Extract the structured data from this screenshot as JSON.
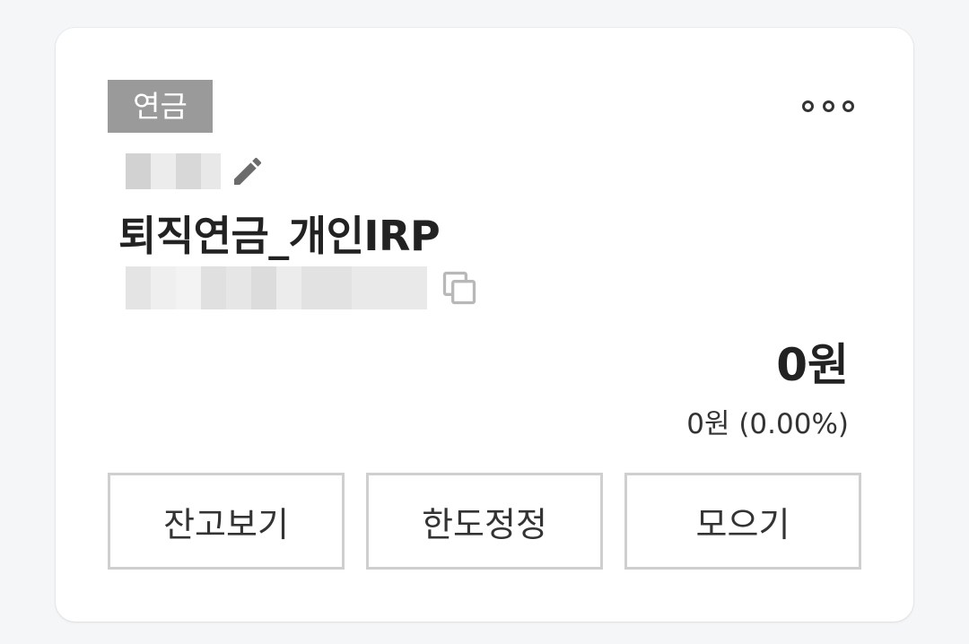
{
  "card": {
    "badge": "연금",
    "account_name": "퇴직연금_개인IRP",
    "balance": "0원",
    "profit": "0원 (0.00%)"
  },
  "icons": {
    "more": "more-horizontal-icon",
    "edit": "pencil-icon",
    "copy": "copy-icon"
  },
  "buttons": {
    "balance_view": "잔고보기",
    "limit_setting": "한도정정",
    "deposit": "모으기"
  },
  "colors": {
    "badge_bg": "#9a9a9a",
    "button_border": "#cfcfcf",
    "text_primary": "#222222"
  }
}
